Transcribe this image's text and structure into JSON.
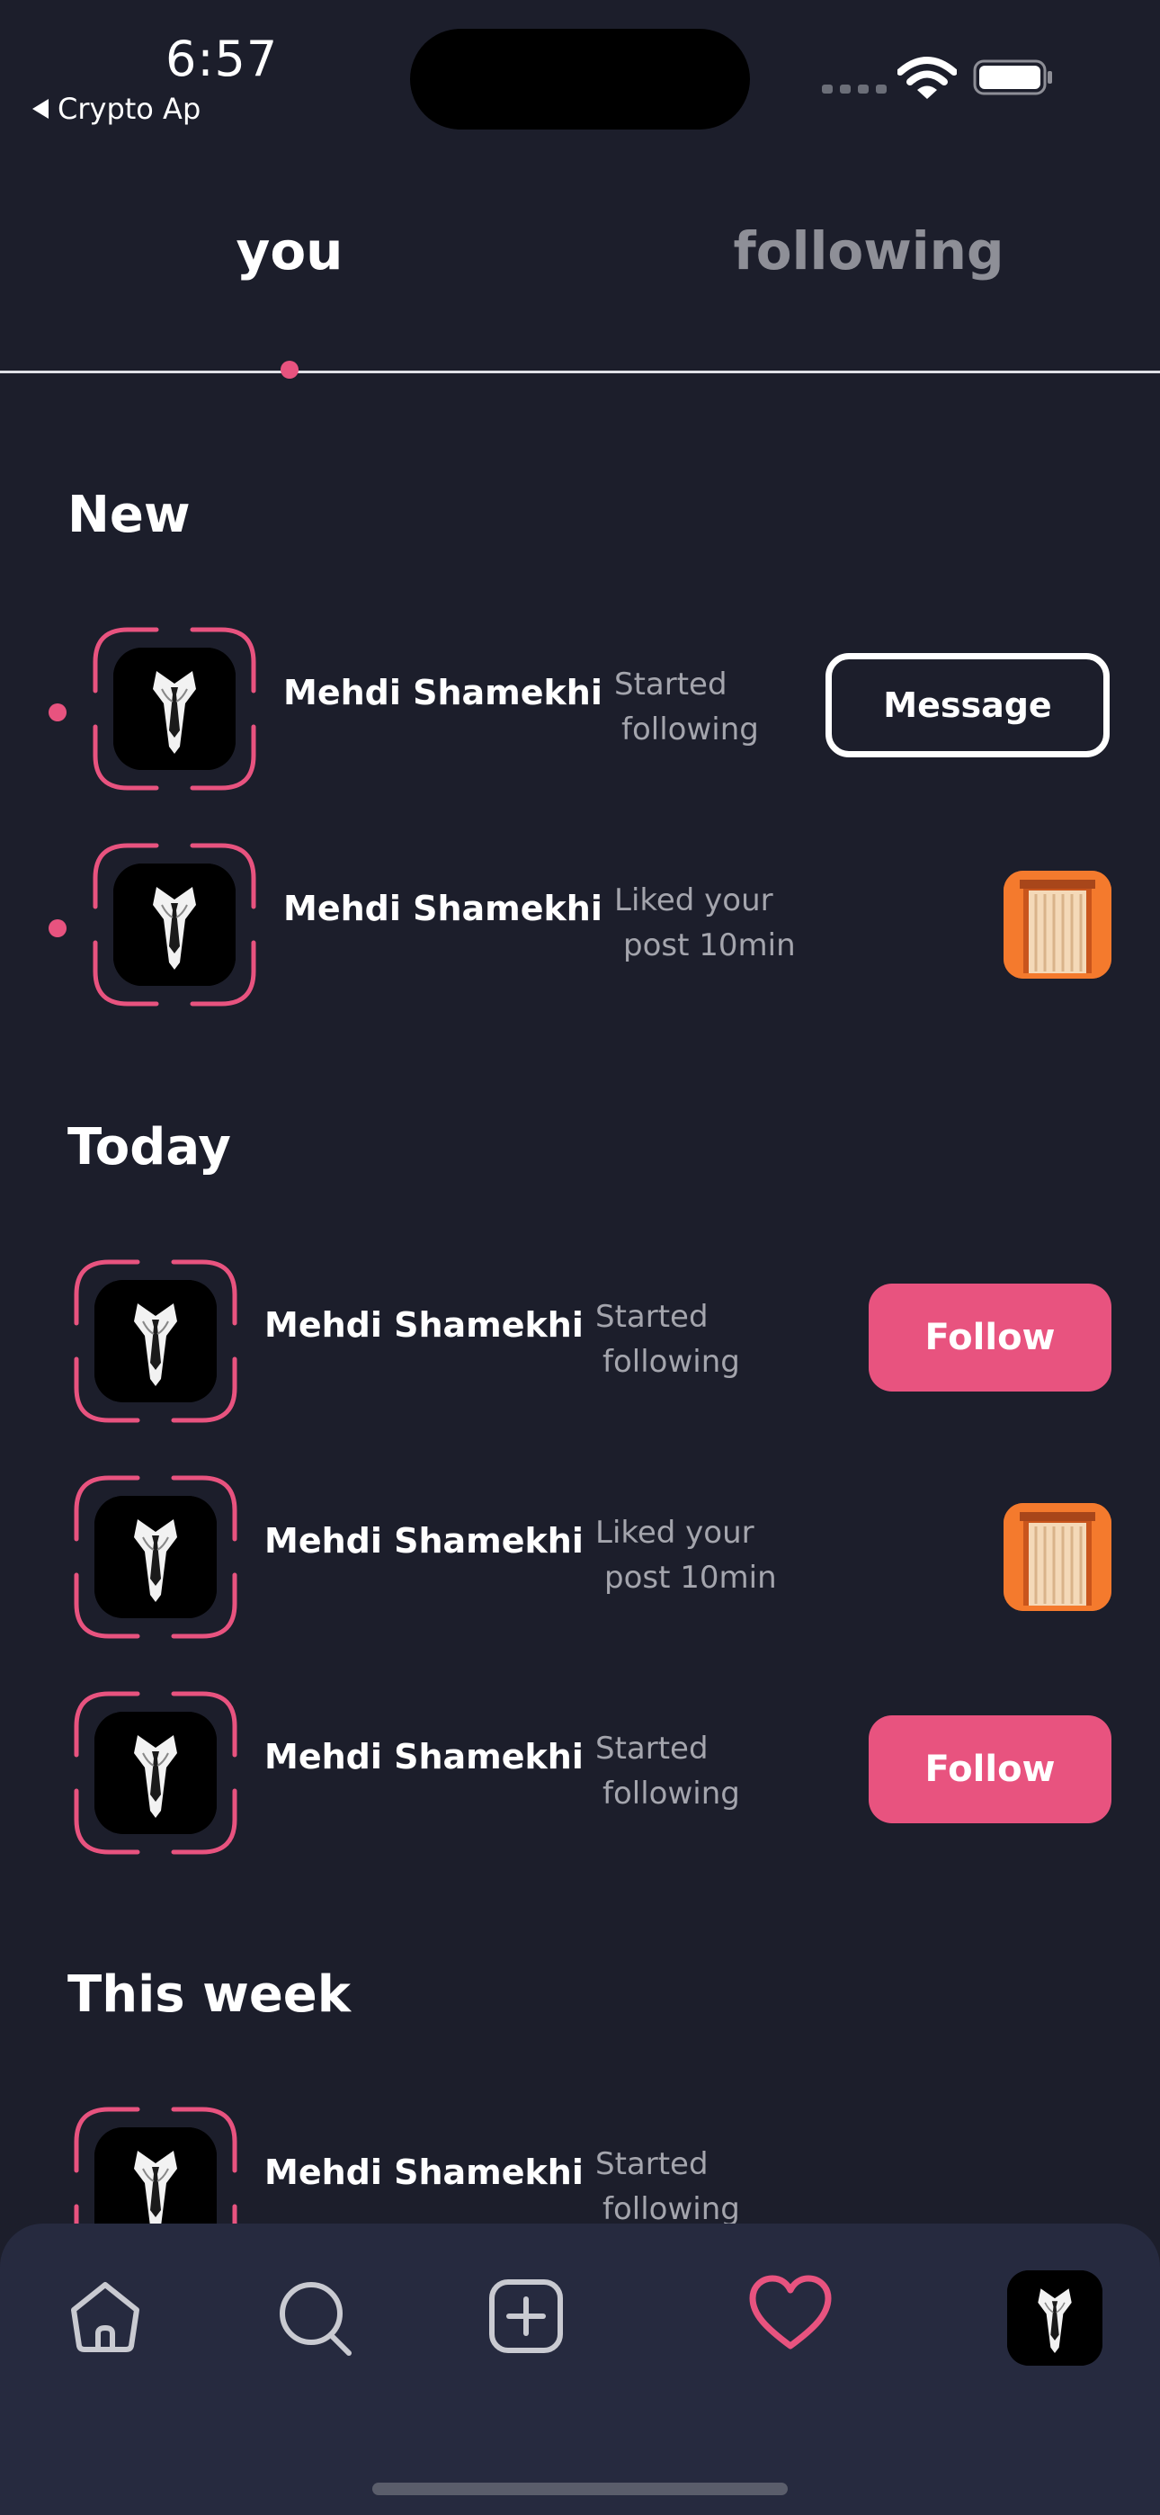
{
  "status_bar": {
    "time": "6:57",
    "back_app": "Crypto Ap"
  },
  "tabs": [
    {
      "label": "you",
      "active": true
    },
    {
      "label": "following",
      "active": false
    }
  ],
  "colors": {
    "background": "#1c1e2b",
    "accent": "#e8537f",
    "nav_background": "#262a3f",
    "muted_text": "#a4a5ad"
  },
  "sections": {
    "new": {
      "title": "New",
      "items": [
        {
          "name": "Mehdi Shamekhi",
          "action_line1": "Started",
          "action_line2": "following",
          "button": "Message",
          "unread": true
        },
        {
          "name": "Mehdi Shamekhi",
          "action_line1": "Liked your",
          "action_line2": "post 10min",
          "thumbnail": "post-thumbnail",
          "unread": true
        }
      ]
    },
    "today": {
      "title": "Today",
      "items": [
        {
          "name": "Mehdi Shamekhi",
          "action_line1": "Started",
          "action_line2": "following",
          "button": "Follow"
        },
        {
          "name": "Mehdi Shamekhi",
          "action_line1": "Liked your",
          "action_line2": "post 10min",
          "thumbnail": "post-thumbnail"
        },
        {
          "name": "Mehdi Shamekhi",
          "action_line1": "Started",
          "action_line2": "following",
          "button": "Follow"
        }
      ]
    },
    "this_week": {
      "title": "This week",
      "items": [
        {
          "name": "Mehdi Shamekhi",
          "action_line1": "Started",
          "action_line2": "following"
        }
      ]
    }
  },
  "bottom_nav": {
    "items": [
      {
        "icon": "home-icon",
        "active": false
      },
      {
        "icon": "search-icon",
        "active": false
      },
      {
        "icon": "add-post-icon",
        "active": false
      },
      {
        "icon": "heart-icon",
        "active": true
      },
      {
        "icon": "profile-avatar",
        "active": false
      }
    ]
  }
}
